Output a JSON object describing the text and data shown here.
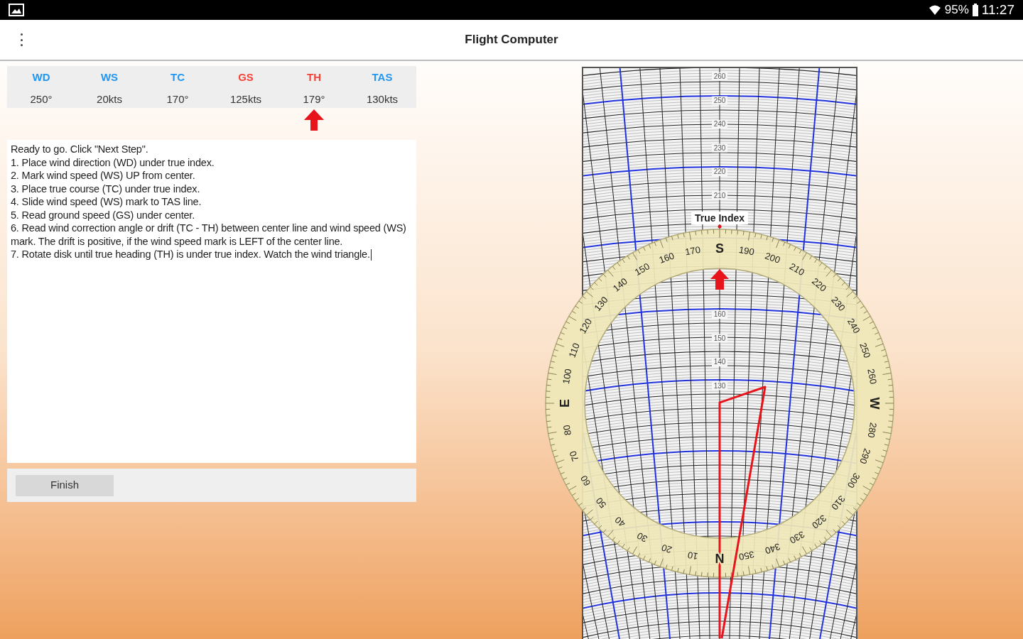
{
  "status_bar": {
    "battery": "95%",
    "time": "11:27"
  },
  "app_bar": {
    "title": "Flight Computer"
  },
  "values": [
    {
      "label": "WD",
      "value": "250°",
      "color": "#2196f3",
      "selected": false
    },
    {
      "label": "WS",
      "value": "20kts",
      "color": "#2196f3",
      "selected": false
    },
    {
      "label": "TC",
      "value": "170°",
      "color": "#2196f3",
      "selected": false
    },
    {
      "label": "GS",
      "value": "125kts",
      "color": "#f44336",
      "selected": false
    },
    {
      "label": "TH",
      "value": "179°",
      "color": "#f44336",
      "selected": true
    },
    {
      "label": "TAS",
      "value": "130kts",
      "color": "#2196f3",
      "selected": false
    }
  ],
  "instructions": [
    "Ready to go. Click \"Next Step\".",
    "1. Place wind direction (WD) under true index.",
    "2. Mark wind speed (WS) UP from center.",
    "3. Place true course (TC) under true index.",
    "4. Slide wind speed (WS) mark to TAS line.",
    "5. Read ground speed (GS) under center.",
    "6. Read wind correction angle or drift (TC - TH) between center line and wind speed (WS) mark. The drift is positive, if the wind speed mark is LEFT of the center line.",
    "7. Rotate disk until true heading (TH) is under true index. Watch the wind triangle."
  ],
  "finish_button": "Finish",
  "computer": {
    "true_index": "True Index",
    "ring_labels": [
      "N",
      "10",
      "20",
      "30",
      "40",
      "50",
      "60",
      "70",
      "80",
      "E",
      "100",
      "110",
      "120",
      "130",
      "140",
      "150",
      "160",
      "170",
      "S",
      "190",
      "200",
      "210",
      "220",
      "230",
      "240",
      "250",
      "260",
      "W",
      "280",
      "290",
      "300",
      "310",
      "320",
      "330",
      "340",
      "350"
    ],
    "slide_speed_labels": [
      "260",
      "250",
      "240",
      "230",
      "220",
      "210"
    ],
    "disk_speed_labels": [
      "160",
      "150",
      "140",
      "130"
    ]
  }
}
